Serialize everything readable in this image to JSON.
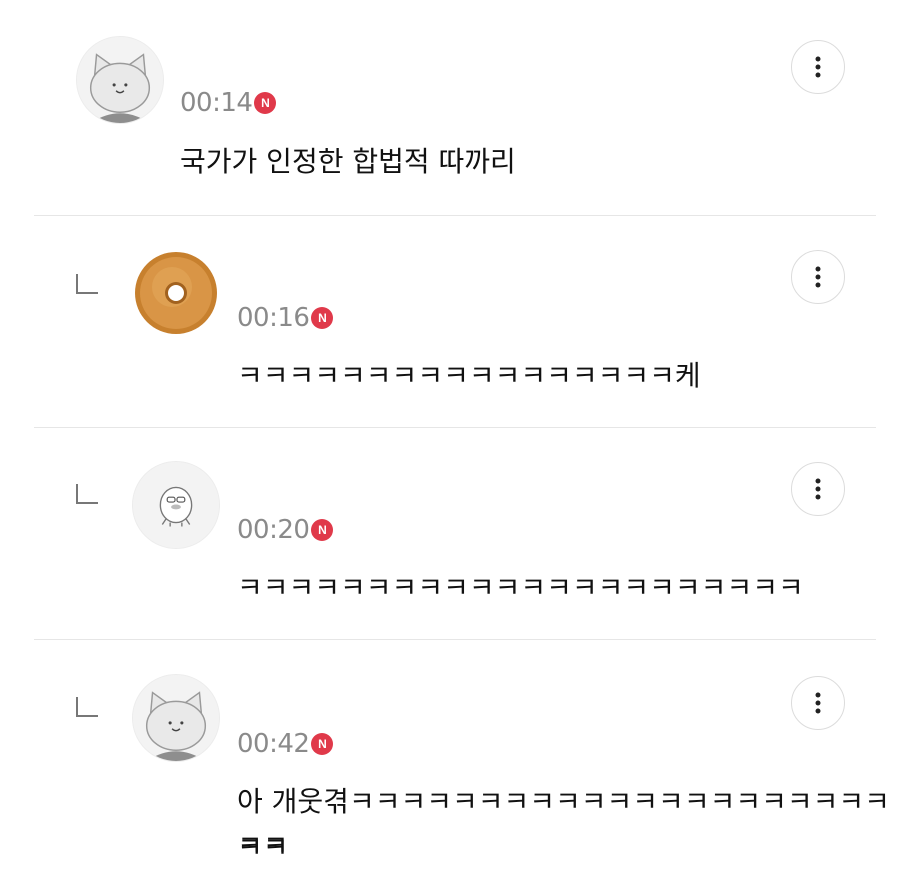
{
  "comments": [
    {
      "avatar": "cat-avatar",
      "time": "00:14",
      "badge": "N",
      "text": "국가가 인정한 합법적 따까리",
      "is_reply": false
    },
    {
      "avatar": "donut-avatar",
      "time": "00:16",
      "badge": "N",
      "text": "ㅋㅋㅋㅋㅋㅋㅋㅋㅋㅋㅋㅋㅋㅋㅋㅋㅋ케",
      "is_reply": true
    },
    {
      "avatar": "duck-avatar",
      "time": "00:20",
      "badge": "N",
      "text": "ㅋㅋㅋㅋㅋㅋㅋㅋㅋㅋㅋㅋㅋㅋㅋㅋㅋㅋㅋㅋㅋㅋ",
      "is_reply": true
    },
    {
      "avatar": "cat-avatar",
      "time": "00:42",
      "badge": "N",
      "text_line1": "아 개웃겪ㅋㅋㅋㅋㅋㅋㅋㅋㅋㅋㅋㅋㅋㅋㅋㅋㅋㅋㅋㅋㅋㅋㅋ",
      "text_line2": "ㅋㅋ",
      "is_reply": true
    }
  ],
  "more_icon": "vertical-dots-icon",
  "colors": {
    "badge": "#e0394a",
    "time": "#8a8a8a",
    "divider": "#e6e6e6"
  }
}
